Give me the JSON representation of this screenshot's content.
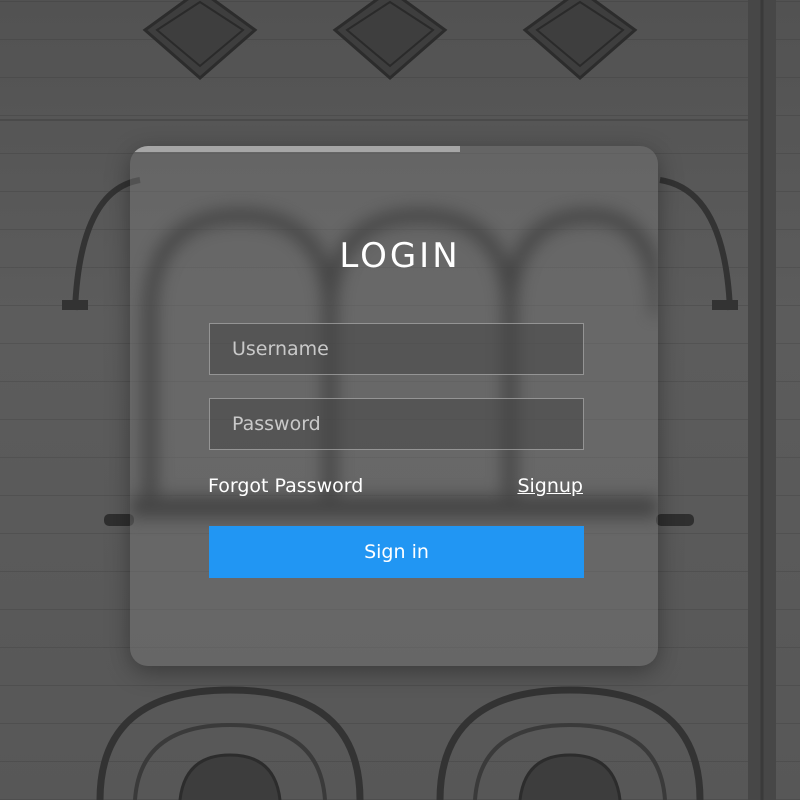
{
  "login": {
    "title": "LOGIN",
    "username_placeholder": "Username",
    "password_placeholder": "Password",
    "forgot_label": "Forgot Password",
    "signup_label": "Signup",
    "signin_label": "Sign in"
  },
  "colors": {
    "accent": "#2196f3",
    "card": "rgba(120,120,120,0.45)",
    "background": "#5a5a5a"
  }
}
